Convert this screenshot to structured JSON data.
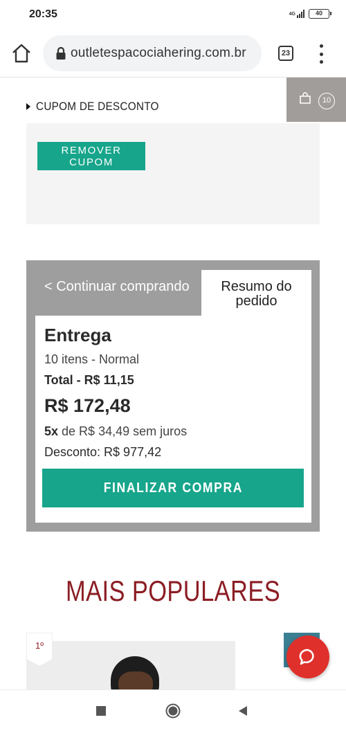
{
  "status_bar": {
    "time": "20:35",
    "network": "4G",
    "battery": "40"
  },
  "browser": {
    "url": "outletespacociahering.com.br",
    "tab_count": "23"
  },
  "cart": {
    "count": "10"
  },
  "coupon": {
    "toggle_label": "CUPOM DE DESCONTO",
    "remove_label": "REMOVER CUPOM"
  },
  "summary": {
    "continue_tab": "< Continuar comprando",
    "summary_tab": "Resumo do pedido",
    "title": "Entrega",
    "items": "10 itens - Normal",
    "shipping_total": "Total - R$ 11,15",
    "price": "R$ 172,48",
    "installments_count": "5x",
    "installments_rest": " de R$ 34,49 sem juros",
    "discount": "Desconto: R$ 977,42",
    "finalize_label": "FINALIZAR COMPRA"
  },
  "popular": {
    "title": "MAIS POPULARES",
    "first_rank": "1º"
  },
  "colors": {
    "accent_green": "#17a68c",
    "brand_red": "#8b1e24",
    "panel_gray": "#9e9e9e",
    "chat_red": "#e0302b"
  },
  "icons": [
    "home-icon",
    "lock-icon",
    "bag-icon",
    "chat-icon",
    "nav-recents-icon",
    "nav-home-icon",
    "nav-back-icon"
  ]
}
